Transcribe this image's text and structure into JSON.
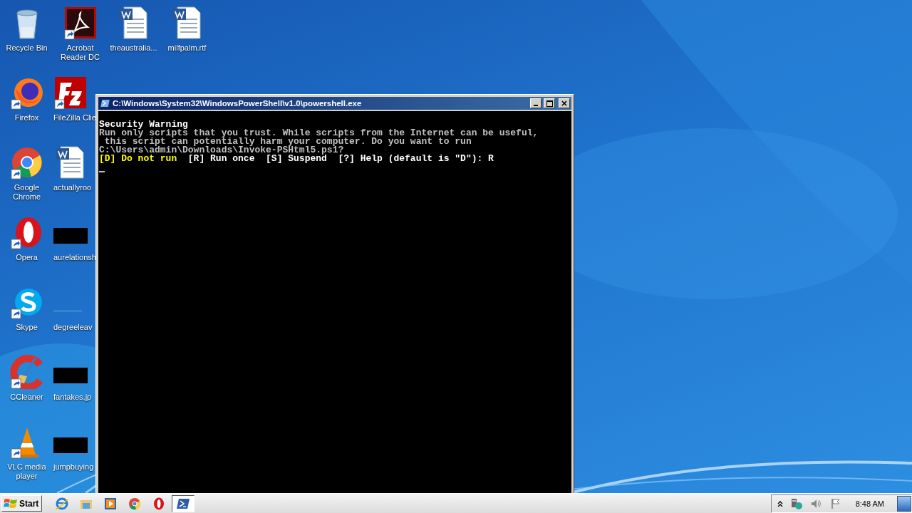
{
  "desktop": {
    "icon_rows": [
      [
        {
          "label": "Recycle Bin",
          "kind": "recycle-bin",
          "shortcut": false
        },
        {
          "label": "Acrobat Reader DC",
          "kind": "acrobat",
          "shortcut": true
        },
        {
          "label": "theaustralia...",
          "kind": "word-doc",
          "shortcut": false
        },
        {
          "label": "milfpalm.rtf",
          "kind": "word-doc",
          "shortcut": false
        }
      ],
      [
        {
          "label": "Firefox",
          "kind": "firefox",
          "shortcut": true
        },
        {
          "label": "FileZilla Clie",
          "kind": "filezilla",
          "shortcut": true
        }
      ],
      [
        {
          "label": "Google Chrome",
          "kind": "chrome",
          "shortcut": true
        },
        {
          "label": "actuallyroo",
          "kind": "word-doc",
          "shortcut": false
        }
      ],
      [
        {
          "label": "Opera",
          "kind": "opera",
          "shortcut": true
        },
        {
          "label": "aurelationsh",
          "kind": "redacted",
          "shortcut": false
        }
      ],
      [
        {
          "label": "Skype",
          "kind": "skype",
          "shortcut": true
        },
        {
          "label": "degreeleav",
          "kind": "blank",
          "shortcut": false
        }
      ],
      [
        {
          "label": "CCleaner",
          "kind": "ccleaner",
          "shortcut": true
        },
        {
          "label": "fantakes.jp",
          "kind": "redacted",
          "shortcut": false
        }
      ],
      [
        {
          "label": "VLC media player",
          "kind": "vlc",
          "shortcut": true
        },
        {
          "label": "jumpbuying",
          "kind": "redacted",
          "shortcut": false
        }
      ]
    ]
  },
  "console_window": {
    "title": "C:\\Windows\\System32\\WindowsPowerShell\\v1.0\\powershell.exe",
    "lines": [
      {
        "text": "Security Warning",
        "kind": "heading"
      },
      {
        "text": "Run only scripts that you trust. While scripts from the Internet can be useful,",
        "kind": "normal"
      },
      {
        "text": " this script can potentially harm your computer. Do you want to run",
        "kind": "normal"
      },
      {
        "text": "C:\\Users\\admin\\Downloads\\Invoke-PSHtml5.ps1?",
        "kind": "normal"
      }
    ],
    "prompt": [
      {
        "text": "[D] Do not run",
        "highlighted": true
      },
      {
        "text": "  [R] Run once  [S] Suspend  [?] Help (default is \"D\"): R",
        "highlighted": false
      }
    ]
  },
  "taskbar": {
    "start_label": "Start",
    "apps": [
      {
        "kind": "ie",
        "selected": false
      },
      {
        "kind": "explorer",
        "selected": false
      },
      {
        "kind": "media",
        "selected": false
      },
      {
        "kind": "chrome",
        "selected": false
      },
      {
        "kind": "opera",
        "selected": false
      },
      {
        "kind": "powershell",
        "selected": true
      }
    ],
    "clock": "8:48 AM"
  }
}
